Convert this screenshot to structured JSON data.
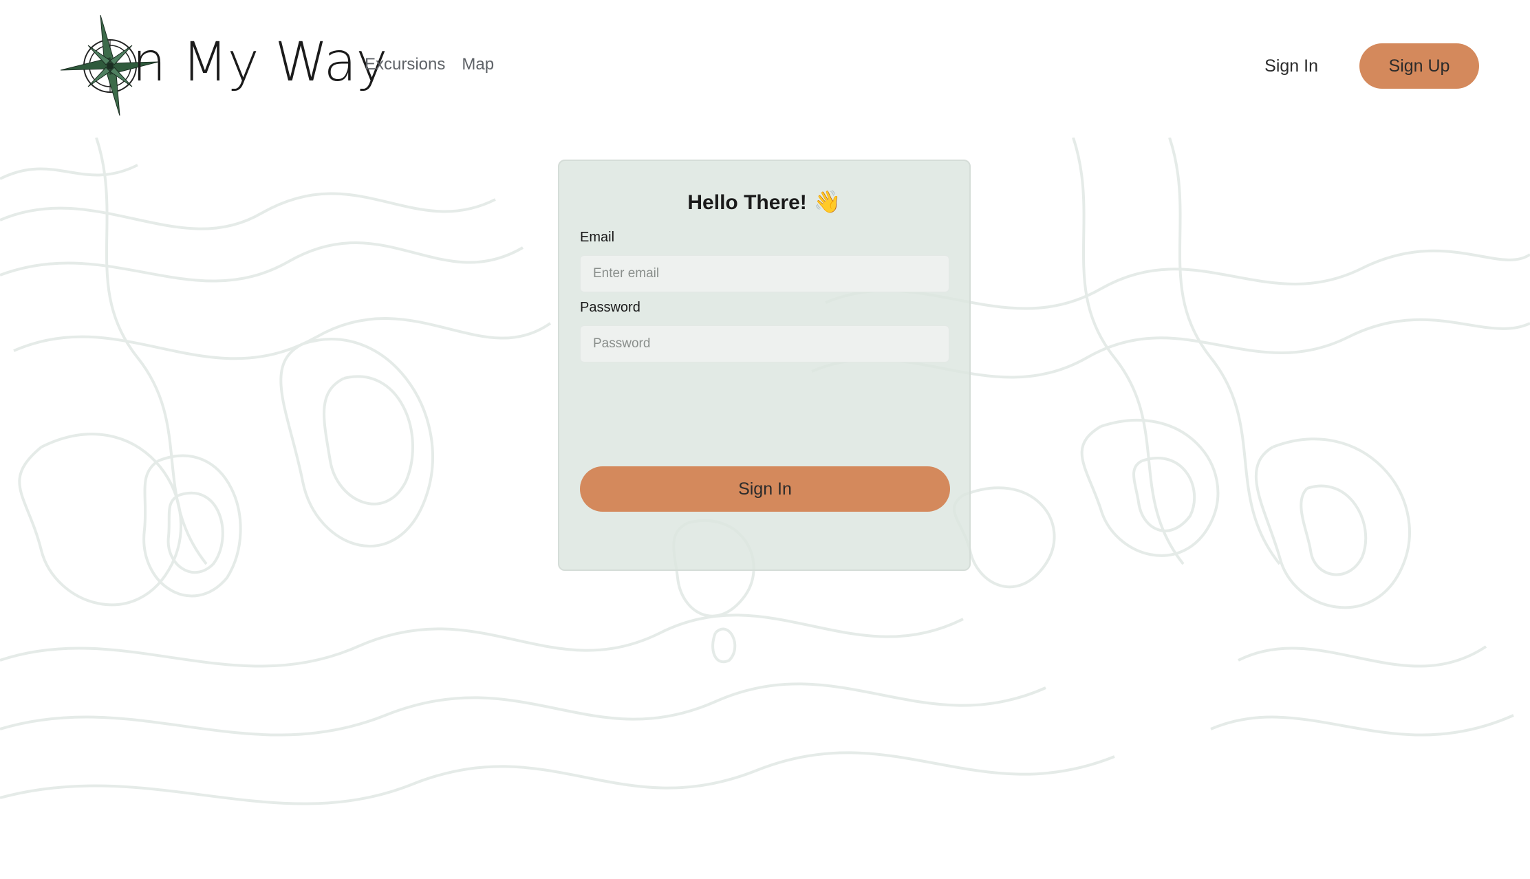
{
  "navbar": {
    "brand": "n My Way",
    "links": [
      "Excursions",
      "Map"
    ],
    "sign_in": "Sign In",
    "sign_up": "Sign Up"
  },
  "login": {
    "title": "Hello There!",
    "wave_emoji": "👋",
    "email_label": "Email",
    "email_placeholder": "Enter email",
    "password_label": "Password",
    "password_placeholder": "Password",
    "submit": "Sign In"
  },
  "colors": {
    "accent": "#d4895c",
    "card_bg": "#dce5df",
    "compass_green": "#3d6b4a",
    "topo_lines": "#e5ebe8"
  }
}
